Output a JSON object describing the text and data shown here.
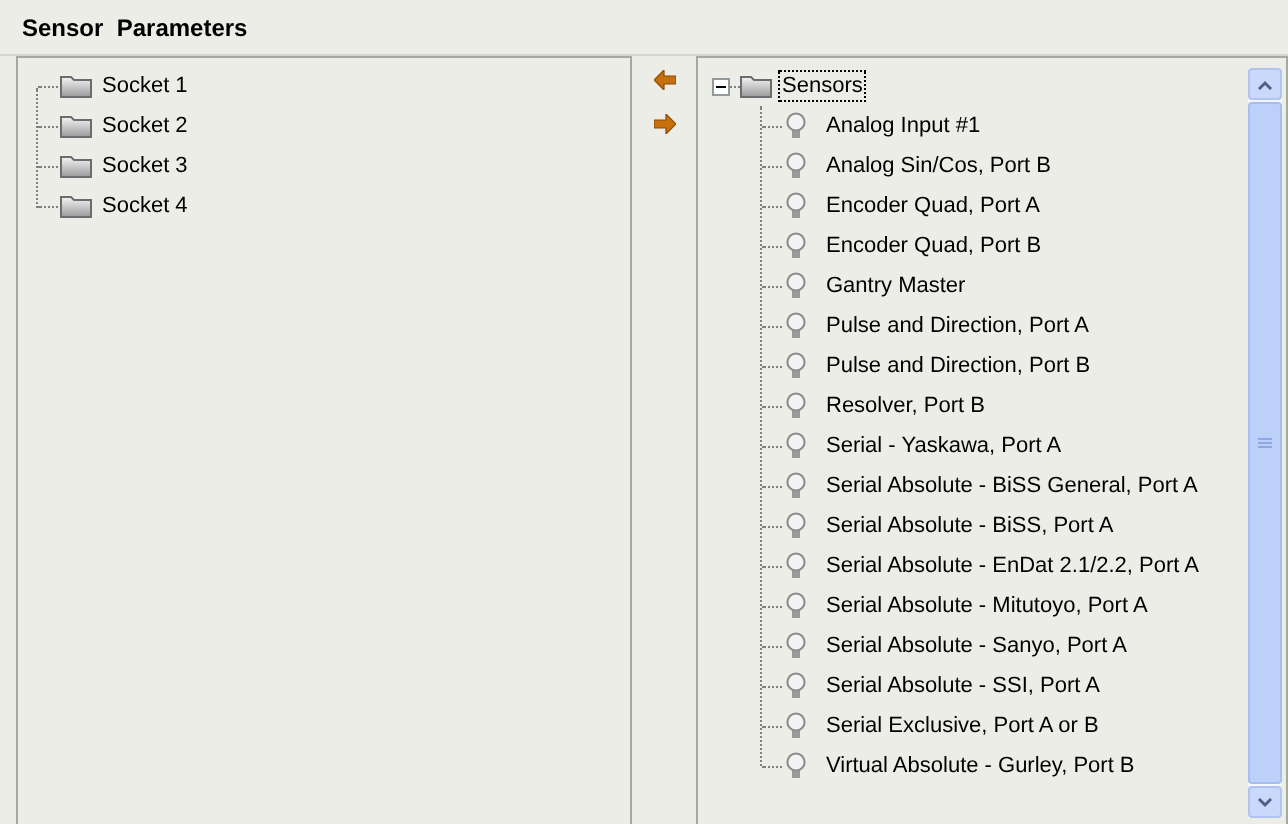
{
  "title": "Sensor  Parameters",
  "sockets": [
    {
      "label": "Socket 1",
      "selected": false
    },
    {
      "label": "Socket 2",
      "selected": false
    },
    {
      "label": "Socket 3",
      "selected": false
    },
    {
      "label": "Socket 4",
      "selected": false
    }
  ],
  "sensors": {
    "label": "Sensors",
    "expanded": true,
    "selected": true,
    "children": [
      {
        "label": "Analog Input #1",
        "selected": false
      },
      {
        "label": "Analog Sin/Cos, Port B",
        "selected": false
      },
      {
        "label": "Encoder Quad, Port A",
        "selected": false
      },
      {
        "label": "Encoder Quad, Port B",
        "selected": false
      },
      {
        "label": "Gantry Master",
        "selected": false
      },
      {
        "label": "Pulse and Direction, Port A",
        "selected": false
      },
      {
        "label": "Pulse and Direction, Port B",
        "selected": false
      },
      {
        "label": "Resolver, Port B",
        "selected": false
      },
      {
        "label": "Serial - Yaskawa, Port A",
        "selected": false
      },
      {
        "label": "Serial Absolute - BiSS General, Port A",
        "selected": false
      },
      {
        "label": "Serial Absolute - BiSS, Port A",
        "selected": false
      },
      {
        "label": "Serial Absolute - EnDat 2.1/2.2, Port A",
        "selected": false
      },
      {
        "label": "Serial Absolute - Mitutoyo, Port A",
        "selected": false
      },
      {
        "label": "Serial Absolute - Sanyo, Port A",
        "selected": false
      },
      {
        "label": "Serial Absolute - SSI, Port A",
        "selected": false
      },
      {
        "label": "Serial Exclusive, Port A or B",
        "selected": false
      },
      {
        "label": "Virtual Absolute - Gurley, Port B",
        "selected": false
      }
    ]
  }
}
